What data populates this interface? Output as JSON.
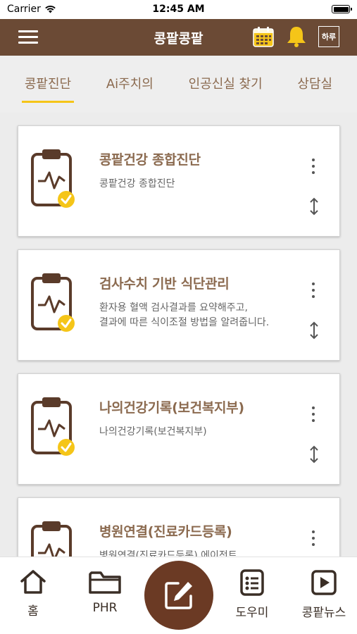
{
  "status_bar": {
    "carrier": "Carrier",
    "time": "12:45 AM"
  },
  "header": {
    "title": "콩팥콩팥",
    "day_button_label": "하루",
    "bg_color": "#6b4a35"
  },
  "tabs": [
    {
      "label": "콩팥진단",
      "active": true
    },
    {
      "label": "Ai주치의",
      "active": false
    },
    {
      "label": "인공신실 찾기",
      "active": false
    },
    {
      "label": "상담실",
      "active": false
    }
  ],
  "cards": [
    {
      "title": "콩팥건강 종합진단",
      "description": "콩팥건강 종합진단"
    },
    {
      "title": "검사수치 기반 식단관리",
      "description": "환자용 혈액 검사결과를 요약해주고,\n결과에 따른 식이조절 방법을 알려줍니다."
    },
    {
      "title": "나의건강기록(보건복지부)",
      "description": "나의건강기록(보건복지부)"
    },
    {
      "title": "병원연결(진료카드등록)",
      "description": "병원연결(진료카드등록) 에이전트"
    }
  ],
  "bottom_nav": {
    "items": [
      {
        "label": "홈",
        "icon": "home-icon"
      },
      {
        "label": "PHR",
        "icon": "folder-icon"
      },
      {
        "label": "도우미",
        "icon": "checklist-icon"
      },
      {
        "label": "콩팥뉴스",
        "icon": "play-icon"
      }
    ],
    "fab_icon": "edit-icon"
  },
  "colors": {
    "brand_brown": "#6b4a35",
    "accent_yellow": "#f5c518",
    "title_brown": "#8b6a4f"
  }
}
